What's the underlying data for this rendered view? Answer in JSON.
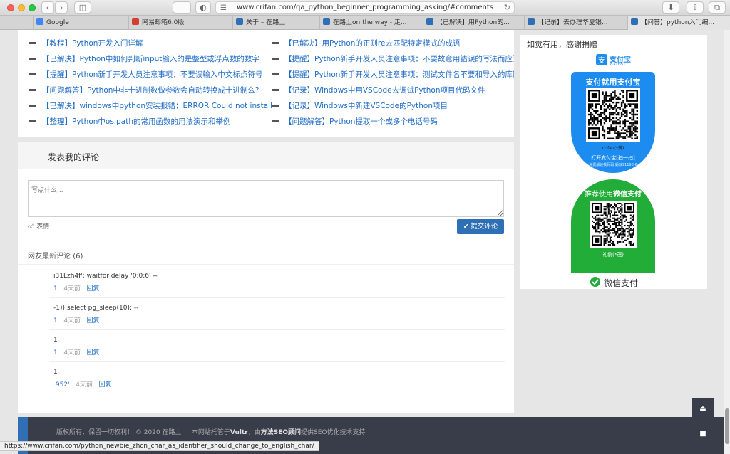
{
  "browser": {
    "url": "www.crifan.com/qa_python_beginner_programming_asking/#comments",
    "tabs": [
      {
        "label": "Google",
        "fav_color": "#4285f4"
      },
      {
        "label": "网易邮箱6.0版",
        "fav_color": "#d23f31"
      },
      {
        "label": "关于 – 在路上",
        "fav_color": "#2f6fb5"
      },
      {
        "label": "在路上on the way - 走...",
        "fav_color": "#2f6fb5"
      },
      {
        "label": "【已解决】用Python的...",
        "fav_color": "#2f6fb5"
      },
      {
        "label": "【记录】去办理华夏银...",
        "fav_color": "#2f6fb5"
      },
      {
        "label": "【问答】python入门编...",
        "fav_color": "#2f6fb5"
      }
    ],
    "status_url": "https://www.crifan.com/python_newbie_zhcn_char_as_identifier_should_change_to_english_char/"
  },
  "related": {
    "left": [
      "【教程】Python开发入门详解",
      "【已解决】Python中如何判断input输入的是整型或浮点数的数字",
      "【提醒】Python新手开发人员注意事项：不要误输入中文标点符号",
      "【问题解答】Python中非十进制数做参数会自动转换成十进制么?",
      "【已解决】windows中python安装报错：ERROR Could not install",
      "【整理】Python中os.path的常用函数的用法演示和举例"
    ],
    "right": [
      "【已解决】用Python的正则re去匹配特定模式的成语",
      "【提醒】Python新手开发人员注意事项：不要故意用错误的写法而应该",
      "【提醒】Python新手开发人员注意事项：测试文件名不要和导入的库同",
      "【记录】Windows中用VSCode去调试Python项目代码文件",
      "【记录】Windows中新建VSCode的Python项目",
      "【问题解答】Python提取一个或多个电话号码"
    ]
  },
  "comments": {
    "title": "发表我的评论",
    "placeholder": "写点什么...",
    "emoji_label": "表情",
    "submit_label": "提交评论",
    "latest_title": "网友最新评论",
    "latest_count": "(6)",
    "items": [
      {
        "text": "i31Lzh4f'; waitfor delay '0:0:6' --",
        "num": "1",
        "time": "4天前",
        "reply": "回复"
      },
      {
        "text": "-1));select pg_sleep(10); --",
        "num": "1",
        "time": "4天前",
        "reply": "回复"
      },
      {
        "text": "1",
        "num": "1",
        "time": "4天前",
        "reply": "回复"
      },
      {
        "text": "1",
        "num": ".952'",
        "time": "4天前",
        "reply": "回复"
      }
    ]
  },
  "footer": {
    "copyright": "版权所有，保留一切权利！ © 2020 在路上",
    "hosting_prefix": "本网站托管于",
    "host": "Vultr",
    "by": "，由",
    "seo": "方法SEO顾问",
    "suffix": "提供SEO优化技术支持"
  },
  "sidebar": {
    "title": "如觉有用，感谢捐赠",
    "alipay_logo_text": "支付宝",
    "alipay_logo_sub": "ALIPAY",
    "alipay_head": "支付就用支付宝",
    "alipay_name": "crifan(*茂)",
    "alipay_cap1": "打开支付宝[扫一扫]",
    "alipay_cap2": "免费解读找码码  蚂蚁91198-6",
    "wechat_head_prefix": "推荐使用",
    "wechat_head_bold": "微信支付",
    "wechat_name": "礼貌(*茂)",
    "wechat_pay": "微信支付"
  },
  "colors": {
    "link": "#1f6cc6",
    "alipay_blue": "#1d8cf0",
    "wechat_green": "#22ac38",
    "footer_bg": "#393d49",
    "submit_blue": "#2f6fb5"
  }
}
